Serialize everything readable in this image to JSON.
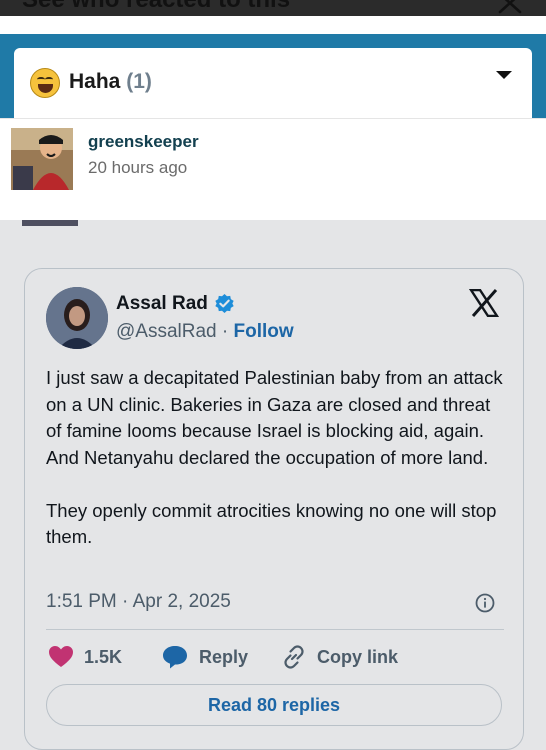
{
  "sheet": {
    "title": "See who reacted to this"
  },
  "reaction": {
    "label": "Haha",
    "count": "(1)",
    "icon": "laughing-face-icon"
  },
  "reactor": {
    "username": "greenskeeper",
    "time_ago": "20 hours ago"
  },
  "tweet": {
    "name": "Assal Rad",
    "handle": "@AssalRad",
    "separator": " · ",
    "follow": "Follow",
    "body": "I just saw a decapitated Palestinian baby from an attack on a UN clinic. Bakeries in Gaza are closed and threat of famine looms because Israel is blocking aid, again. And Netanyahu declared the occupation of more land.\n\nThey openly commit atrocities knowing no one will stop them.",
    "timestamp": "1:51 PM · Apr 2, 2025",
    "likes": "1.5K",
    "reply_label": "Reply",
    "copy_link_label": "Copy link",
    "read_replies": "Read 80 replies"
  },
  "colors": {
    "accent_blue": "#1d6fb5",
    "band_blue": "#1f7aa7",
    "heart": "#d8357a",
    "username": "#13404f"
  }
}
